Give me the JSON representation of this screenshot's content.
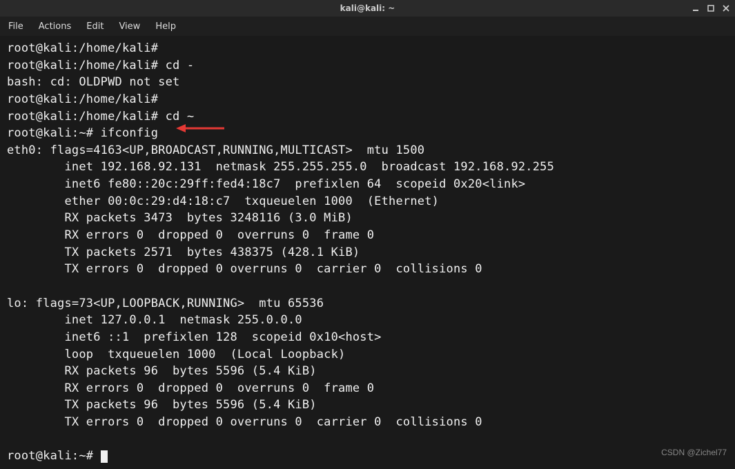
{
  "titlebar": {
    "title": "kali@kali: ~"
  },
  "menubar": {
    "items": [
      "File",
      "Actions",
      "Edit",
      "View",
      "Help"
    ]
  },
  "terminal": {
    "lines": [
      "root@kali:/home/kali#",
      "root@kali:/home/kali# cd -",
      "bash: cd: OLDPWD not set",
      "root@kali:/home/kali#",
      "root@kali:/home/kali# cd ~",
      "root@kali:~# ifconfig",
      "eth0: flags=4163<UP,BROADCAST,RUNNING,MULTICAST>  mtu 1500",
      "        inet 192.168.92.131  netmask 255.255.255.0  broadcast 192.168.92.255",
      "        inet6 fe80::20c:29ff:fed4:18c7  prefixlen 64  scopeid 0x20<link>",
      "        ether 00:0c:29:d4:18:c7  txqueuelen 1000  (Ethernet)",
      "        RX packets 3473  bytes 3248116 (3.0 MiB)",
      "        RX errors 0  dropped 0  overruns 0  frame 0",
      "        TX packets 2571  bytes 438375 (428.1 KiB)",
      "        TX errors 0  dropped 0 overruns 0  carrier 0  collisions 0",
      "",
      "lo: flags=73<UP,LOOPBACK,RUNNING>  mtu 65536",
      "        inet 127.0.0.1  netmask 255.0.0.0",
      "        inet6 ::1  prefixlen 128  scopeid 0x10<host>",
      "        loop  txqueuelen 1000  (Local Loopback)",
      "        RX packets 96  bytes 5596 (5.4 KiB)",
      "        RX errors 0  dropped 0  overruns 0  frame 0",
      "        TX packets 96  bytes 5596 (5.4 KiB)",
      "        TX errors 0  dropped 0 overruns 0  carrier 0  collisions 0",
      "",
      "root@kali:~# "
    ]
  },
  "watermark": "CSDN @Zichel77"
}
